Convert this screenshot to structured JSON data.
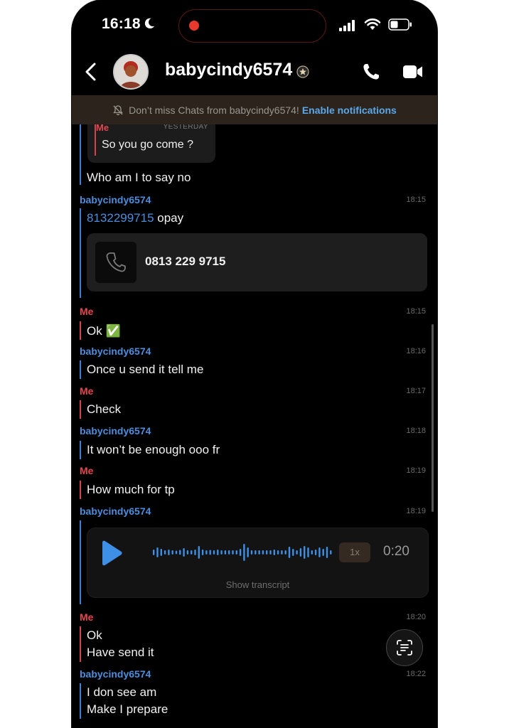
{
  "status": {
    "time": "16:18"
  },
  "header": {
    "title": "babycindy6574"
  },
  "banner": {
    "text": "Don’t miss Chats from babycindy6574!",
    "link": "Enable notifications"
  },
  "quote": {
    "sender": "Me",
    "when": "YESTERDAY",
    "text": "So you go come ?"
  },
  "messages": [
    {
      "sender": "",
      "time": "",
      "lines": [
        "Who am I to say no"
      ]
    },
    {
      "sender": "babycindy6574",
      "time": "18:15",
      "phone_link": "8132299715",
      "text_after": " opay",
      "contact_card": "0813 229 9715"
    },
    {
      "sender": "Me",
      "time": "18:15",
      "lines": [
        "Ok ✅"
      ]
    },
    {
      "sender": "babycindy6574",
      "time": "18:16",
      "lines": [
        "Once u send it tell me"
      ]
    },
    {
      "sender": "Me",
      "time": "18:17",
      "lines": [
        "Check"
      ]
    },
    {
      "sender": "babycindy6574",
      "time": "18:18",
      "lines": [
        "It won’t be enough ooo fr"
      ]
    },
    {
      "sender": "Me",
      "time": "18:19",
      "lines": [
        "How much for tp"
      ]
    },
    {
      "sender": "babycindy6574",
      "time": "18:19",
      "voice": {
        "speed": "1x",
        "duration": "0:20",
        "transcript_label": "Show transcript"
      }
    },
    {
      "sender": "Me",
      "time": "18:20",
      "lines": [
        "Ok",
        "Have send it"
      ]
    },
    {
      "sender": "babycindy6574",
      "time": "18:22",
      "lines": [
        "I don see am",
        "Make I prepare"
      ]
    }
  ],
  "colors": {
    "me": "#e4464f",
    "them": "#4d8edc",
    "link": "#5aa7ea",
    "play": "#3e8fe6"
  }
}
